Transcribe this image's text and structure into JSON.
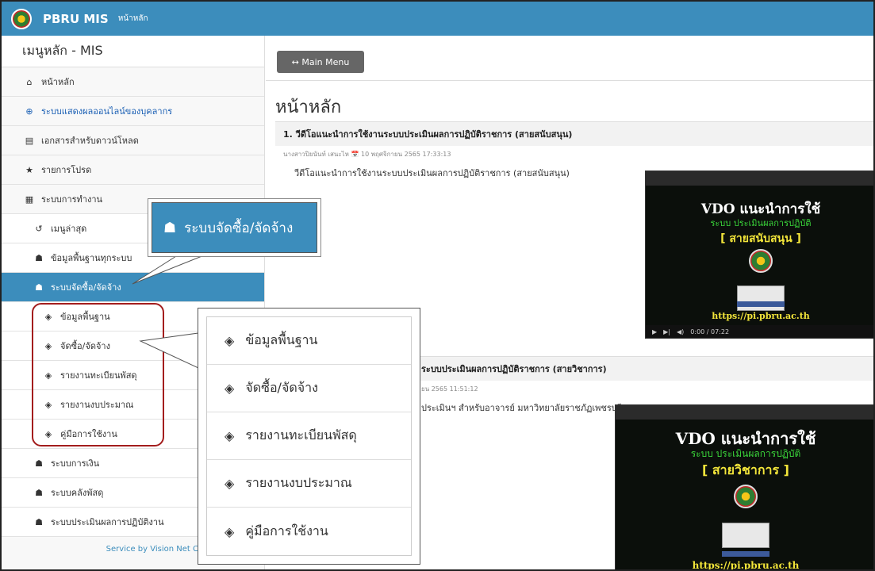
{
  "app": {
    "brand": "PBRU MIS",
    "brand_sub": "หน้าหลัก"
  },
  "sidebar": {
    "title": "เมนูหลัก - MIS",
    "items": [
      {
        "label": "หน้าหลัก",
        "icon": "home-icon"
      },
      {
        "label": "ระบบแสดงผลออนไลน์ของบุคลากร",
        "icon": "globe-icon"
      },
      {
        "label": "เอกสารสำหรับดาวน์โหลด",
        "icon": "document-icon"
      },
      {
        "label": "รายการโปรด",
        "icon": "star-icon"
      },
      {
        "label": "ระบบการทำงาน",
        "icon": "grid-icon"
      },
      {
        "label": "เมนูล่าสุด",
        "icon": "history-icon"
      },
      {
        "label": "ข้อมูลพื้นฐานทุกระบบ",
        "icon": "cubes-icon"
      },
      {
        "label": "ระบบจัดซื้อ/จัดจ้าง",
        "icon": "cubes-icon"
      },
      {
        "label": "ข้อมูลพื้นฐาน",
        "icon": "cube-icon"
      },
      {
        "label": "จัดซื้อ/จัดจ้าง",
        "icon": "cube-icon"
      },
      {
        "label": "รายงานทะเบียนพัสดุ",
        "icon": "cube-icon"
      },
      {
        "label": "รายงานงบประมาณ",
        "icon": "cube-icon"
      },
      {
        "label": "คู่มือการใช้งาน",
        "icon": "cube-icon"
      },
      {
        "label": "ระบบการเงิน",
        "icon": "cubes-icon"
      },
      {
        "label": "ระบบคลังพัสดุ",
        "icon": "cubes-icon"
      },
      {
        "label": "ระบบประเมินผลการปฏิบัติงาน",
        "icon": "cubes-icon"
      }
    ],
    "footer": "Service by Vision Net Co., Ltd"
  },
  "toolbar": {
    "main_menu_label": "↔ Main Menu"
  },
  "main": {
    "page_title": "หน้าหลัก",
    "posts": [
      {
        "title": "1. วีดีโอแนะนำการใช้งานระบบประเมินผลการปฏิบัติราชการ (สายสนับสนุน)",
        "meta": "นางสาวปิยนันท์ เสนะไห 📅 10 พฤศจิกายน 2565 17:33:13",
        "desc": "วีดีโอแนะนำการใช้งานระบบประเมินผลการปฏิบัติราชการ (สายสนับสนุน)",
        "video": {
          "title": "VDO แนะนำการใช้",
          "subtitle": "ระบบ ประเมินผลการปฏิบัติ",
          "tag": "[ สายสนับสนุน ]",
          "url": "https://pi.pbru.ac.th",
          "time": "0:00 / 07:22"
        }
      },
      {
        "title": "ระบบประเมินผลการปฏิบัติราชการ (สายวิชาการ)",
        "meta": "ยน 2565 11:51:12",
        "desc": "ประเมินฯ สำหรับอาจารย์ มหาวิทยาลัยราชภัฏเพชรบุรี",
        "video": {
          "title": "VDO แนะนำการใช้",
          "subtitle": "ระบบ ประเมินผลการปฏิบัติ",
          "tag": "[ สายวิชาการ ]",
          "url": "https://pi.pbru.ac.th"
        }
      }
    ]
  },
  "callouts": {
    "menu": {
      "label": "ระบบจัดซื้อ/จัดจ้าง"
    },
    "submenu": [
      "ข้อมูลพื้นฐาน",
      "จัดซื้อ/จัดจ้าง",
      "รายงานทะเบียนพัสดุ",
      "รายงานงบประมาณ",
      "คู่มือการใช้งาน"
    ]
  },
  "colors": {
    "topbar": "#3c8dbc",
    "active": "#3c8dbc",
    "highlight_box": "#a31d1d"
  }
}
